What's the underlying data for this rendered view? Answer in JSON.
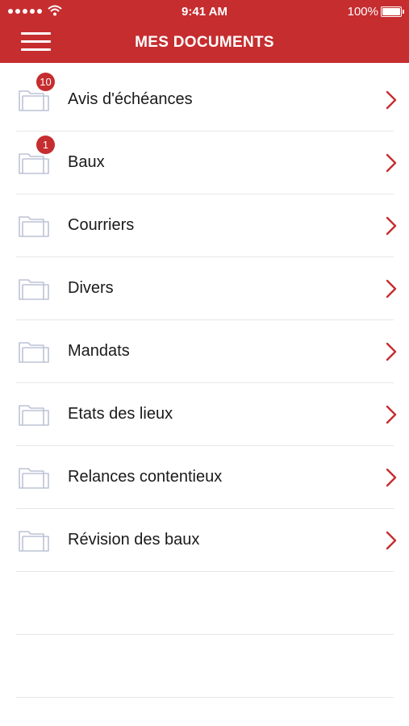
{
  "status": {
    "time": "9:41 AM",
    "battery": "100%"
  },
  "header": {
    "title": "MES DOCUMENTS"
  },
  "colors": {
    "brand": "#c62d2f",
    "separator": "#e6e6e6",
    "folder_stroke": "#bcc3d6"
  },
  "icons": {
    "menu": "hamburger-menu-icon",
    "folder": "folder-icon",
    "chevron": "chevron-right-icon"
  },
  "documents": [
    {
      "label": "Avis d'échéances",
      "badge": "10"
    },
    {
      "label": "Baux",
      "badge": "1"
    },
    {
      "label": "Courriers",
      "badge": ""
    },
    {
      "label": "Divers",
      "badge": ""
    },
    {
      "label": "Mandats",
      "badge": ""
    },
    {
      "label": "Etats des lieux",
      "badge": ""
    },
    {
      "label": "Relances contentieux",
      "badge": ""
    },
    {
      "label": "Révision des baux",
      "badge": ""
    }
  ]
}
